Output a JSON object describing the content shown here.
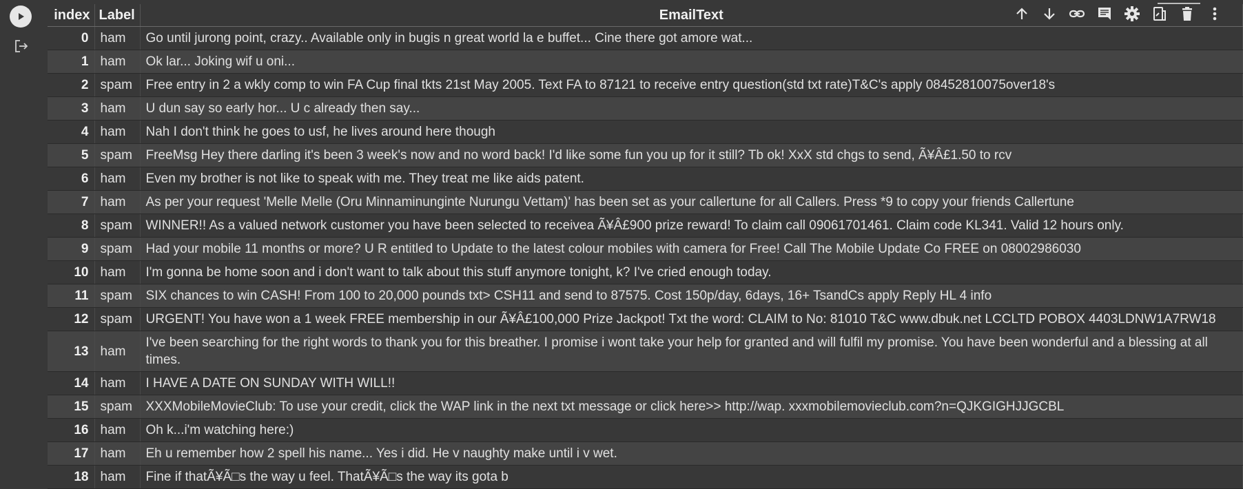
{
  "table": {
    "headers": {
      "index": "index",
      "label": "Label",
      "text": "EmailText"
    },
    "rows": [
      {
        "index": "0",
        "label": "ham",
        "text": "Go until jurong point, crazy.. Available only in bugis n great world la e buffet... Cine there got amore wat..."
      },
      {
        "index": "1",
        "label": "ham",
        "text": "Ok lar... Joking wif u oni..."
      },
      {
        "index": "2",
        "label": "spam",
        "text": "Free entry in 2 a wkly comp to win FA Cup final tkts 21st May 2005. Text FA to 87121 to receive entry question(std txt rate)T&C's apply 08452810075over18's"
      },
      {
        "index": "3",
        "label": "ham",
        "text": "U dun say so early hor... U c already then say..."
      },
      {
        "index": "4",
        "label": "ham",
        "text": "Nah I don't think he goes to usf, he lives around here though"
      },
      {
        "index": "5",
        "label": "spam",
        "text": "FreeMsg Hey there darling it's been 3 week's now and no word back! I'd like some fun you up for it still? Tb ok! XxX std chgs to send, Ã¥Â£1.50 to rcv"
      },
      {
        "index": "6",
        "label": "ham",
        "text": "Even my brother is not like to speak with me. They treat me like aids patent."
      },
      {
        "index": "7",
        "label": "ham",
        "text": "As per your request 'Melle Melle (Oru Minnaminunginte Nurungu Vettam)' has been set as your callertune for all Callers. Press *9 to copy your friends Callertune"
      },
      {
        "index": "8",
        "label": "spam",
        "text": "WINNER!! As a valued network customer you have been selected to receivea Ã¥Â£900 prize reward! To claim call 09061701461. Claim code KL341. Valid 12 hours only."
      },
      {
        "index": "9",
        "label": "spam",
        "text": "Had your mobile 11 months or more? U R entitled to Update to the latest colour mobiles with camera for Free! Call The Mobile Update Co FREE on 08002986030"
      },
      {
        "index": "10",
        "label": "ham",
        "text": "I'm gonna be home soon and i don't want to talk about this stuff anymore tonight, k? I've cried enough today."
      },
      {
        "index": "11",
        "label": "spam",
        "text": "SIX chances to win CASH! From 100 to 20,000 pounds txt> CSH11 and send to 87575. Cost 150p/day, 6days, 16+ TsandCs apply Reply HL 4 info"
      },
      {
        "index": "12",
        "label": "spam",
        "text": "URGENT! You have won a 1 week FREE membership in our Ã¥Â£100,000 Prize Jackpot! Txt the word: CLAIM to No: 81010 T&C www.dbuk.net LCCLTD POBOX 4403LDNW1A7RW18"
      },
      {
        "index": "13",
        "label": "ham",
        "text": "I've been searching for the right words to thank you for this breather. I promise i wont take your help for granted and will fulfil my promise. You have been wonderful and a blessing at all times."
      },
      {
        "index": "14",
        "label": "ham",
        "text": "I HAVE A DATE ON SUNDAY WITH WILL!!"
      },
      {
        "index": "15",
        "label": "spam",
        "text": "XXXMobileMovieClub: To use your credit, click the WAP link in the next txt message or click here>> http://wap. xxxmobilemovieclub.com?n=QJKGIGHJJGCBL"
      },
      {
        "index": "16",
        "label": "ham",
        "text": "Oh k...i'm watching here:)"
      },
      {
        "index": "17",
        "label": "ham",
        "text": "Eh u remember how 2 spell his name... Yes i did. He v naughty make until i v wet."
      },
      {
        "index": "18",
        "label": "ham",
        "text": "Fine if thatÃ¥Ã□s the way u feel. ThatÃ¥Ã□s the way its gota b"
      }
    ]
  },
  "icons": {
    "run": "play-icon",
    "output": "output-icon",
    "toolbar": [
      "arrow-up-icon",
      "arrow-down-icon",
      "link-icon",
      "comment-icon",
      "gear-icon",
      "mirror-cell-icon",
      "trash-icon",
      "more-vert-icon"
    ]
  },
  "colors": {
    "background": "#383838",
    "row_alt": "#444444",
    "text": "#e0e0e0"
  }
}
